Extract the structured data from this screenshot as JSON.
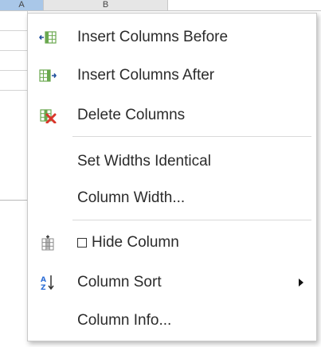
{
  "spreadsheet": {
    "column_headers": [
      "A",
      "B",
      ""
    ]
  },
  "context_menu": {
    "items": [
      {
        "id": "insert_before",
        "label": "Insert Columns Before",
        "icon": "insert-columns-before-icon"
      },
      {
        "id": "insert_after",
        "label": "Insert Columns After",
        "icon": "insert-columns-after-icon"
      },
      {
        "id": "delete",
        "label": "Delete Columns",
        "icon": "delete-columns-icon"
      },
      {
        "id": "set_widths",
        "label": "Set Widths Identical",
        "icon": ""
      },
      {
        "id": "column_width",
        "label": "Column Width...",
        "icon": ""
      },
      {
        "id": "hide_column",
        "label": "Hide Column",
        "icon": "hide-column-icon",
        "checkbox": true,
        "checked": false
      },
      {
        "id": "column_sort",
        "label": "Column Sort",
        "icon": "sort-az-icon",
        "has_submenu": true
      },
      {
        "id": "column_info",
        "label": "Column Info...",
        "icon": ""
      }
    ]
  },
  "colors": {
    "selected_header": "#a9c7e8",
    "header": "#e6e6e6",
    "grid_icon": "#6aa84f",
    "arrow_blue": "#1f4e9c",
    "delete_red": "#d9362b",
    "sort_blue": "#2f6fd6"
  }
}
